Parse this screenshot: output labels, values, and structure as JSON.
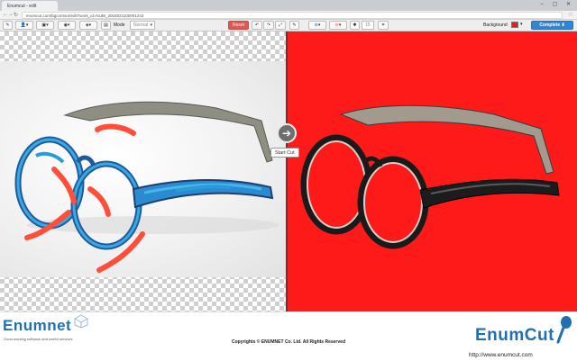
{
  "browser": {
    "tab_title": "Enumcut - edit",
    "url": "enumcut.com/bgcontour/edit?work_id=NUBI_2016021100001243",
    "window_controls": "– ▢ ✕"
  },
  "toolbar": {
    "mode_label": "Mode",
    "mode_value": "Normal",
    "reset_label": "Reset",
    "size_value": "15",
    "background_label": "Background",
    "background_color": "#e81c1c",
    "complete_label": "Complete"
  },
  "canvas": {
    "start_cut_label": "Start Cut",
    "foreground_mark_color": "#2a9bd9",
    "background_mark_color": "#ff4f3a",
    "preview_background": "#ff1a1a"
  },
  "footer": {
    "brand_left": "Enumnet",
    "brand_left_tagline": "Good-working software and useful services",
    "copyright": "Copyrights © ENUMNET Co. Ltd. All Rights Reserved",
    "brand_right": "EnumCut",
    "website": "http://www.enumcut.com"
  }
}
